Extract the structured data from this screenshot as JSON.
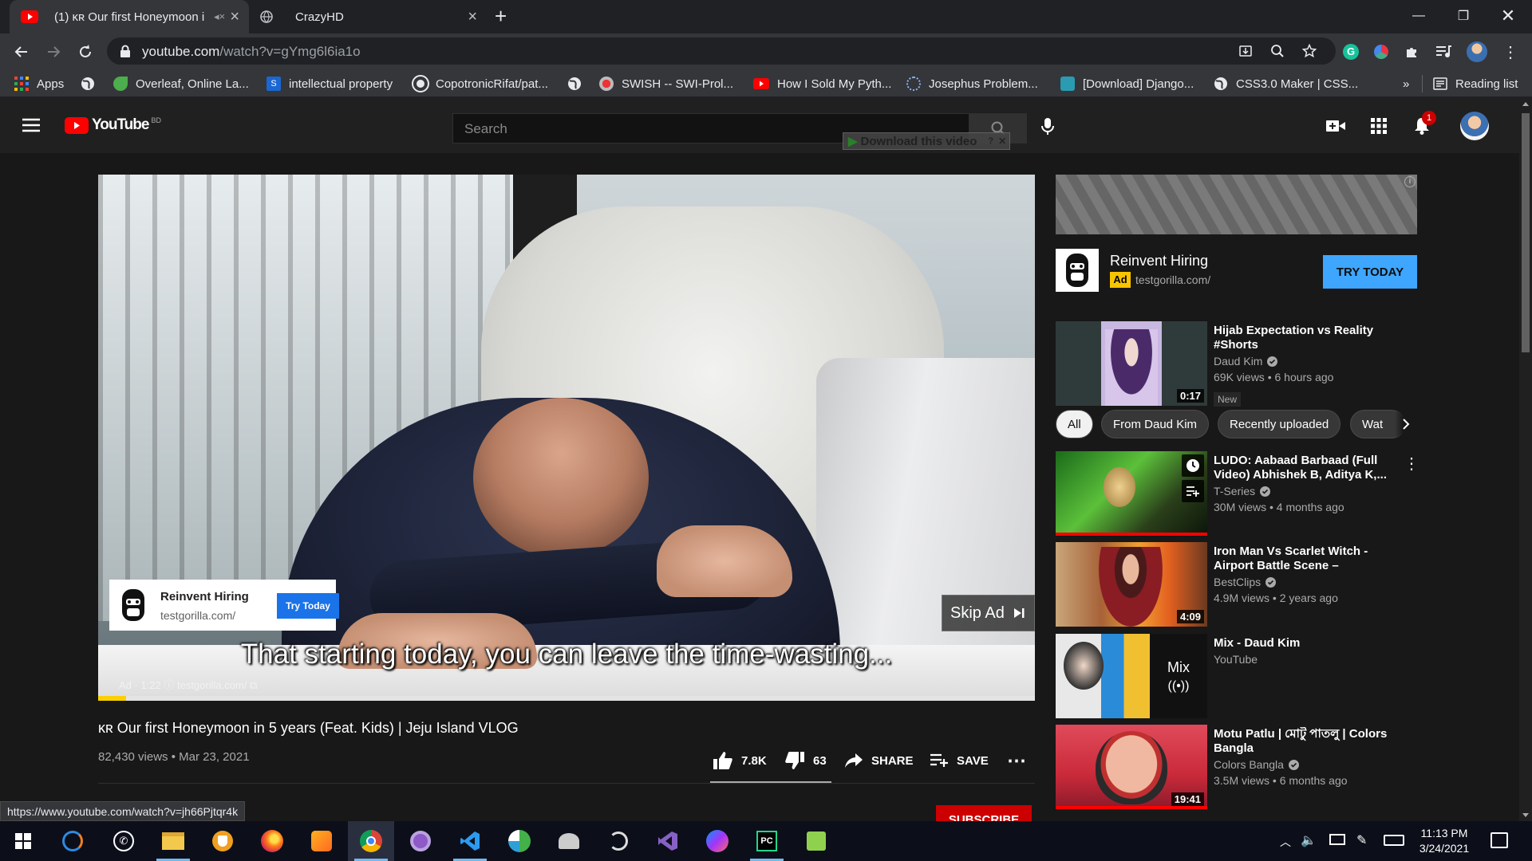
{
  "browser": {
    "tabs": [
      {
        "title": "(1) ᴋʀ Our first Honeymoon i",
        "active": true
      },
      {
        "title": "CrazyHD",
        "active": false
      }
    ],
    "new_tab_icon": "plus-icon",
    "url_host": "youtube.com",
    "url_path": "/watch?v=gYmg6l6ia1o",
    "bookmarks": [
      {
        "label": "Apps",
        "icon": "apps-grid-icon"
      },
      {
        "label": "",
        "icon": "globe-icon"
      },
      {
        "label": "Overleaf, Online La...",
        "icon": "overleaf-icon"
      },
      {
        "label": "intellectual property",
        "icon": "s-icon"
      },
      {
        "label": "CopotronicRifat/pat...",
        "icon": "github-icon"
      },
      {
        "label": "",
        "icon": "globe-icon"
      },
      {
        "label": "SWISH -- SWI-Prol...",
        "icon": "swish-icon"
      },
      {
        "label": "How I Sold My Pyth...",
        "icon": "youtube-icon"
      },
      {
        "label": "Josephus Problem...",
        "icon": "loading-icon"
      },
      {
        "label": "[Download] Django...",
        "icon": "site-icon"
      },
      {
        "label": "CSS3.0 Maker | CSS...",
        "icon": "globe-icon"
      }
    ],
    "more_bookmarks": "»",
    "reading_list": "Reading list"
  },
  "youtube": {
    "logo_text": "YouTube",
    "country_code": "BD",
    "search_placeholder": "Search",
    "download_helper": "Download this video",
    "notification_count": "1"
  },
  "player": {
    "ad_card": {
      "name": "Reinvent Hiring",
      "domain": "testgorilla.com/",
      "button": "Try Today"
    },
    "skip_ad": "Skip Ad",
    "subtitle": "That starting today, you can leave the time-wasting...",
    "ad_info": "Ad · 1:22 ⓘ  testgorilla.com/ ⧉",
    "progress_fraction": 0.03
  },
  "video": {
    "title": "ᴋʀ Our first Honeymoon in 5 years (Feat. Kids) | Jeju Island VLOG",
    "views": "82,430 views",
    "date": "Mar 23, 2021",
    "likes": "7.8K",
    "dislikes": "63",
    "share": "SHARE",
    "save": "SAVE",
    "subscribe": "SUBSCRIBE"
  },
  "sidebar_ad": {
    "name": "Reinvent Hiring",
    "badge": "Ad",
    "domain": "testgorilla.com/",
    "button": "TRY TODAY"
  },
  "chips": [
    "All",
    "From Daud Kim",
    "Recently uploaded",
    "Wat"
  ],
  "recommendations": [
    {
      "title": "Hijab Expectation vs Reality #Shorts",
      "channel": "Daud Kim",
      "verified": true,
      "meta": "69K views • 6 hours ago",
      "duration": "0:17",
      "badge": "New"
    },
    {
      "title": "LUDO: Aabaad Barbaad (Full Video) Abhishek B, Aditya K,...",
      "channel": "T-Series",
      "verified": true,
      "meta": "30M views • 4 months ago",
      "duration": ""
    },
    {
      "title": "Iron Man Vs Scarlet Witch - Airport Battle Scene – Captain...",
      "channel": "BestClips",
      "verified": true,
      "meta": "4.9M views • 2 years ago",
      "duration": "4:09"
    },
    {
      "title": "Mix - Daud Kim",
      "channel": "YouTube",
      "verified": false,
      "meta": "",
      "duration": "",
      "mix_label": "Mix"
    },
    {
      "title": "Motu Patlu | মোটু পাতলু | Colors Bangla",
      "channel": "Colors Bangla",
      "verified": true,
      "meta": "3.5M views • 6 months ago",
      "duration": "19:41"
    }
  ],
  "status_url": "https://www.youtube.com/watch?v=jh66Pjtqr4k",
  "taskbar": {
    "time": "11:13 PM",
    "date": "3/24/2021"
  },
  "colors": {
    "youtube_red": "#ff0000",
    "accent_blue": "#3ea6ff",
    "ad_yellow": "#f8c400"
  }
}
